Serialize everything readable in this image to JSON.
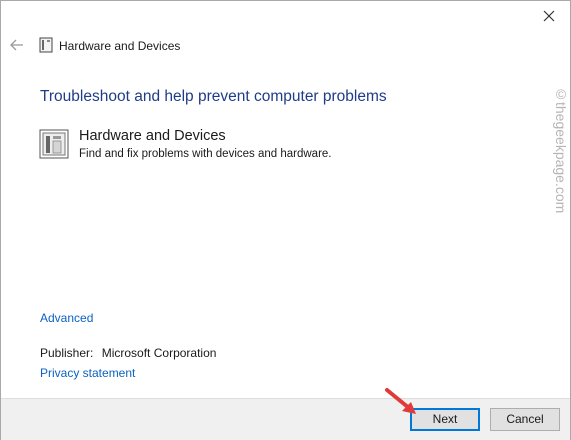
{
  "window": {
    "title": "Hardware and Devices"
  },
  "main": {
    "heading": "Troubleshoot and help prevent computer problems",
    "troubleshooter": {
      "title": "Hardware and Devices",
      "description": "Find and fix problems with devices and hardware."
    },
    "advanced_link": "Advanced",
    "publisher_label": "Publisher:",
    "publisher_value": "Microsoft Corporation",
    "privacy_link": "Privacy statement"
  },
  "watermark": "©thegeekpage.com",
  "footer": {
    "next_label": "Next",
    "cancel_label": "Cancel"
  },
  "icons": {
    "close": "close-icon",
    "back": "back-arrow-icon",
    "device": "hardware-device-icon",
    "pointer": "red-arrow-icon"
  },
  "colors": {
    "heading": "#1f3c88",
    "link": "#0b62c2",
    "footer_bg": "#f0f0f0",
    "focus_border": "#0078d7",
    "arrow": "#e03a3a"
  }
}
